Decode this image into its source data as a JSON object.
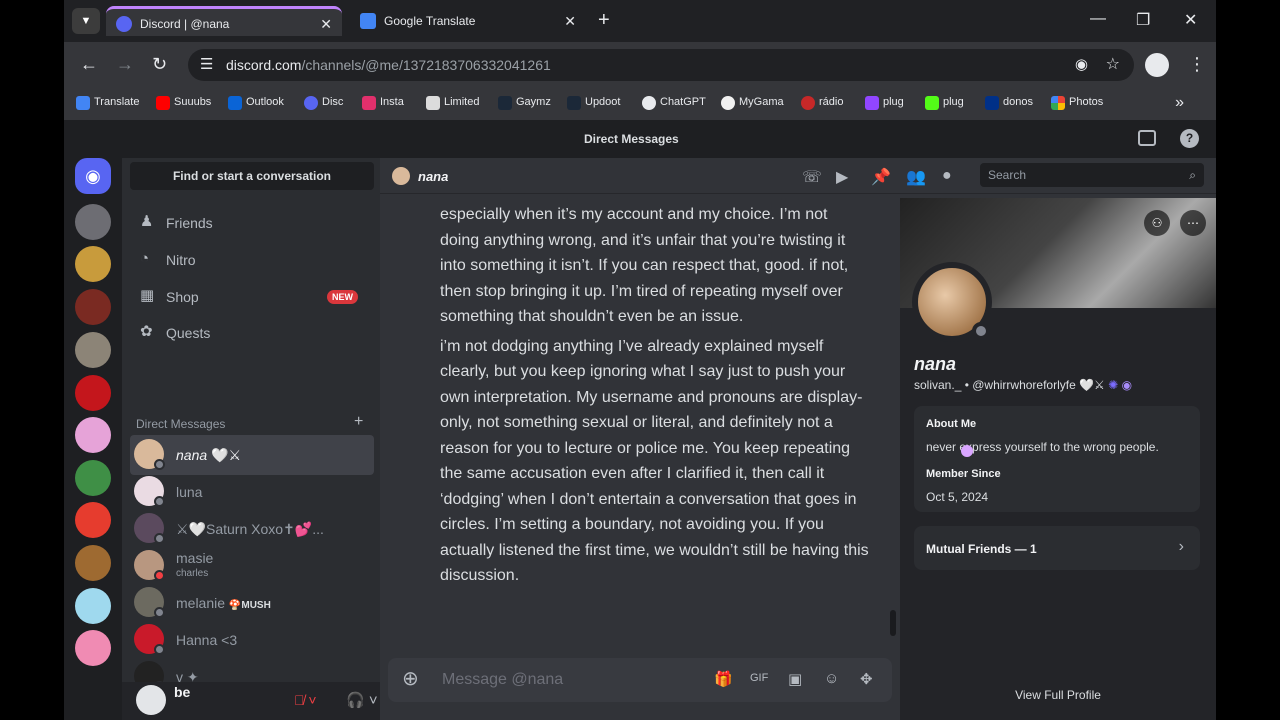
{
  "browser": {
    "tabs": [
      {
        "title": "Discord | @nana",
        "active": true
      },
      {
        "title": "Google Translate",
        "active": false
      }
    ],
    "url_domain": "discord.com",
    "url_path": "/channels/@me/1372183706332041261",
    "bookmarks": [
      "Translate",
      "Suuubs",
      "Outlook",
      "Disc",
      "Insta",
      "Limited",
      "Gaymz",
      "Updoot",
      "ChatGPT",
      "MyGama",
      "rádio",
      "plug",
      "plug",
      "donos",
      "Photos"
    ],
    "colors": {
      "bar": "#35363a",
      "tabbar": "#202124",
      "accent": "#c084fc"
    }
  },
  "discord": {
    "window_title": "Direct Messages",
    "find_placeholder": "Find or start a conversation",
    "nav": [
      {
        "label": "Friends",
        "icon": "friends-icon"
      },
      {
        "label": "Nitro",
        "icon": "nitro-icon"
      },
      {
        "label": "Shop",
        "icon": "shop-icon",
        "badge": "NEW"
      },
      {
        "label": "Quests",
        "icon": "quests-icon"
      }
    ],
    "dm_header": "Direct Messages",
    "dms": [
      {
        "name": "nana",
        "sub": "",
        "status": "offline",
        "active": true,
        "color": "#d9b99b"
      },
      {
        "name": "luna",
        "sub": "",
        "status": "offline",
        "active": false,
        "color": "#eadbe3"
      },
      {
        "name": "⚔🤍Saturn Xoxo✝💕...",
        "sub": "",
        "status": "offline",
        "active": false,
        "color": "#5b4a5e"
      },
      {
        "name": "masie",
        "sub": "charles",
        "status": "dnd",
        "active": false,
        "color": "#b89780"
      },
      {
        "name": "melanie",
        "sub": "",
        "status": "offline",
        "active": false,
        "color": "#6c6a60",
        "tag": "🍄MUSH"
      },
      {
        "name": "Hanna <3",
        "sub": "",
        "status": "offline",
        "active": false,
        "color": "#c91a2a"
      },
      {
        "name": "v",
        "sub": "",
        "status": "offline",
        "active": false,
        "color": "#222222"
      }
    ],
    "user": {
      "name": "be"
    },
    "chat": {
      "recipient": "nana",
      "search_placeholder": "Search",
      "messages": [
        "especially when it’s my account and my choice. I’m not doing anything wrong, and it’s unfair that you’re twisting it into something it isn’t. If you can respect that, good. if not, then stop bringing it up. I’m tired of repeating myself over something that shouldn’t even be an issue.",
        "i’m not dodging anything I’ve already explained myself clearly, but you keep ignoring what I say just to push your own interpretation. My username and pronouns are display-only, not something sexual or literal, and definitely not a reason for you to lecture or police me. You keep repeating the same accusation even after I clarified it, then call it ‘dodging’ when I don’t entertain a conversation that goes in circles. I’m setting a boundary, not avoiding you. If you actually listened the first time, we wouldn’t still be having this discussion."
      ],
      "composer_placeholder": "Message @nana"
    },
    "profile": {
      "display_name": "nana",
      "handle": "solivan._ • @whirrwhoreforlyfe",
      "about_title": "About Me",
      "about_text": "never express yourself to the wrong people.",
      "member_since_title": "Member Since",
      "member_since": "Oct 5, 2024",
      "mutual_friends": "Mutual Friends — 1",
      "view_full": "View Full Profile"
    },
    "colors": {
      "bg": "#313338",
      "sidebar": "#2b2d31",
      "guilds": "#1e1f22",
      "blurple": "#5865f2",
      "dnd": "#f23f43"
    }
  }
}
